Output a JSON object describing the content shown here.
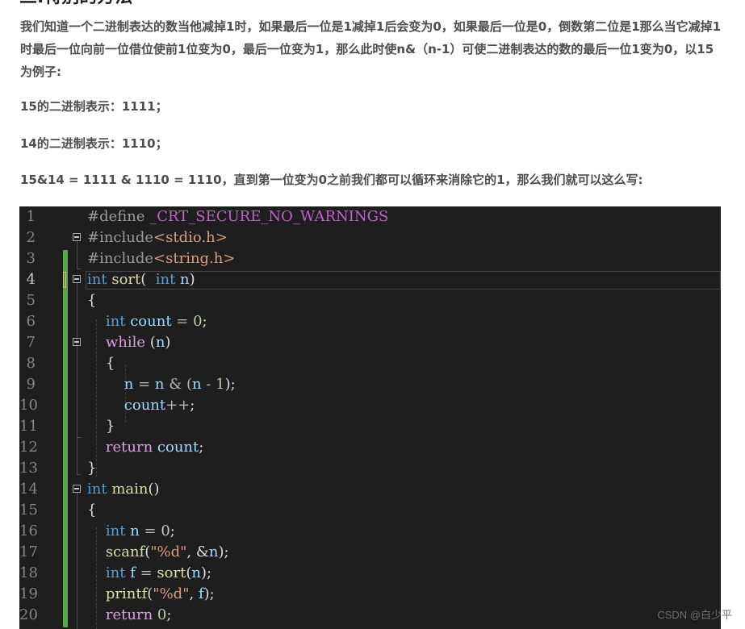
{
  "article": {
    "heading": "三.特别的方法",
    "paragraphs": [
      "我们知道一个二进制表达的数当他减掉1时，如果最后一位是1减掉1后会变为0，如果最后一位是0，倒数第二位是1那么当它减掉1时最后一位向前一位借位使前1位变为0，最后一位变为1，那么此时使n&（n-1）可使二进制表达的数的最后一位1变为0，以15为例子:",
      "15的二进制表示：1111；",
      "14的二进制表示：1110；",
      "15&14 = 1111 & 1110 = 1110，直到第一位变为0之前我们都可以循环来消除它的1，那么我们就可以这么写:"
    ]
  },
  "code": {
    "current_line": 4,
    "lines": [
      {
        "n": "1",
        "tokens": [
          {
            "t": "#define ",
            "c": "pp"
          },
          {
            "t": "_CRT_SECURE_NO_WARNINGS",
            "c": "mac"
          }
        ]
      },
      {
        "n": "2",
        "tokens": [
          {
            "t": "#include",
            "c": "pp"
          },
          {
            "t": "<stdio.h>",
            "c": "inc"
          }
        ]
      },
      {
        "n": "3",
        "tokens": [
          {
            "t": "#include",
            "c": "pp"
          },
          {
            "t": "<string.h>",
            "c": "inc"
          }
        ]
      },
      {
        "n": "4",
        "tokens": [
          {
            "t": "int",
            "c": "kw"
          },
          {
            "t": " "
          },
          {
            "t": "sort",
            "c": "fn"
          },
          {
            "t": "(  "
          },
          {
            "t": "int",
            "c": "kw"
          },
          {
            "t": " "
          },
          {
            "t": "n",
            "c": "var"
          },
          {
            "t": ")"
          }
        ]
      },
      {
        "n": "5",
        "tokens": [
          {
            "t": "{"
          }
        ]
      },
      {
        "n": "6",
        "tokens": [
          {
            "t": "    "
          },
          {
            "t": "int",
            "c": "kw"
          },
          {
            "t": " "
          },
          {
            "t": "count",
            "c": "var"
          },
          {
            "t": " = ",
            "c": "op"
          },
          {
            "t": "0",
            "c": "num"
          },
          {
            "t": ";"
          }
        ]
      },
      {
        "n": "7",
        "tokens": [
          {
            "t": "    "
          },
          {
            "t": "while",
            "c": "kw2"
          },
          {
            "t": " ("
          },
          {
            "t": "n",
            "c": "var"
          },
          {
            "t": ")"
          }
        ]
      },
      {
        "n": "8",
        "tokens": [
          {
            "t": "    {"
          }
        ]
      },
      {
        "n": "9",
        "tokens": [
          {
            "t": "        "
          },
          {
            "t": "n",
            "c": "var"
          },
          {
            "t": " = ",
            "c": "op"
          },
          {
            "t": "n",
            "c": "var"
          },
          {
            "t": " & (",
            "c": "op"
          },
          {
            "t": "n",
            "c": "var"
          },
          {
            "t": " - ",
            "c": "op"
          },
          {
            "t": "1",
            "c": "num"
          },
          {
            "t": ");"
          }
        ]
      },
      {
        "n": "10",
        "tokens": [
          {
            "t": "        "
          },
          {
            "t": "count",
            "c": "var"
          },
          {
            "t": "++",
            "c": "op"
          },
          {
            "t": ";"
          }
        ]
      },
      {
        "n": "11",
        "tokens": [
          {
            "t": "    }"
          }
        ]
      },
      {
        "n": "12",
        "tokens": [
          {
            "t": "    "
          },
          {
            "t": "return",
            "c": "kw2"
          },
          {
            "t": " "
          },
          {
            "t": "count",
            "c": "var"
          },
          {
            "t": ";"
          }
        ]
      },
      {
        "n": "13",
        "tokens": [
          {
            "t": "}"
          }
        ]
      },
      {
        "n": "14",
        "tokens": [
          {
            "t": "int",
            "c": "kw"
          },
          {
            "t": " "
          },
          {
            "t": "main",
            "c": "fn"
          },
          {
            "t": "()"
          }
        ]
      },
      {
        "n": "15",
        "tokens": [
          {
            "t": "{"
          }
        ]
      },
      {
        "n": "16",
        "tokens": [
          {
            "t": "    "
          },
          {
            "t": "int",
            "c": "kw"
          },
          {
            "t": " "
          },
          {
            "t": "n",
            "c": "var"
          },
          {
            "t": " = ",
            "c": "op"
          },
          {
            "t": "0",
            "c": "num"
          },
          {
            "t": ";"
          }
        ]
      },
      {
        "n": "17",
        "tokens": [
          {
            "t": "    "
          },
          {
            "t": "scanf",
            "c": "fn"
          },
          {
            "t": "("
          },
          {
            "t": "\"%d\"",
            "c": "str"
          },
          {
            "t": ", &"
          },
          {
            "t": "n",
            "c": "var"
          },
          {
            "t": ");"
          }
        ]
      },
      {
        "n": "18",
        "tokens": [
          {
            "t": "    "
          },
          {
            "t": "int",
            "c": "kw"
          },
          {
            "t": " "
          },
          {
            "t": "f",
            "c": "var"
          },
          {
            "t": " = ",
            "c": "op"
          },
          {
            "t": "sort",
            "c": "fn"
          },
          {
            "t": "("
          },
          {
            "t": "n",
            "c": "var"
          },
          {
            "t": ");"
          }
        ]
      },
      {
        "n": "19",
        "tokens": [
          {
            "t": "    "
          },
          {
            "t": "printf",
            "c": "fn"
          },
          {
            "t": "("
          },
          {
            "t": "\"%d\"",
            "c": "str"
          },
          {
            "t": ", "
          },
          {
            "t": "f",
            "c": "var"
          },
          {
            "t": ");"
          }
        ]
      },
      {
        "n": "20",
        "tokens": [
          {
            "t": "    "
          },
          {
            "t": "return",
            "c": "kw2"
          },
          {
            "t": " "
          },
          {
            "t": "0",
            "c": "num"
          },
          {
            "t": ";"
          }
        ]
      }
    ],
    "collapse_markers": [
      "2",
      "4",
      "7",
      "14"
    ]
  },
  "watermark": "CSDN @白少平"
}
